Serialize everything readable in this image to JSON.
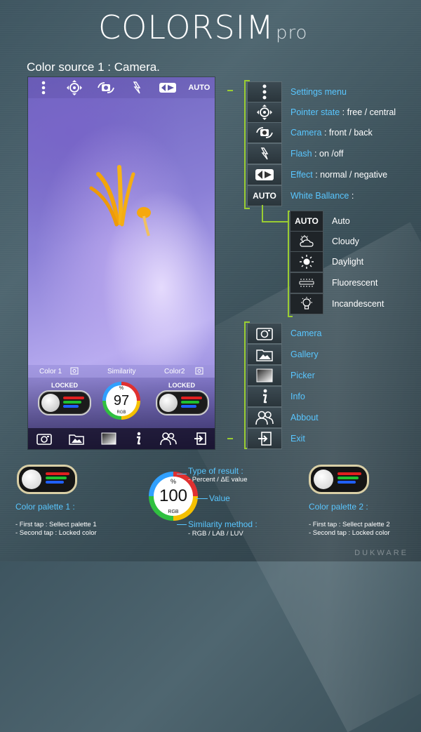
{
  "title": {
    "main": "COLORSIM",
    "sub": "pro"
  },
  "source_label": "Color source 1 : Camera.",
  "phone": {
    "top_auto": "AUTO",
    "panel": {
      "color1": "Color 1",
      "similarity": "Similarity",
      "color2": "Color2",
      "locked_left": "LOCKED",
      "locked_right": "LOCKED",
      "gauge_pct": "%",
      "gauge_value": "97",
      "gauge_method": "RGB"
    }
  },
  "top_menu": [
    {
      "icon": "dots-vertical-icon",
      "label": "Settings menu",
      "detail": ""
    },
    {
      "icon": "pointer-target-icon",
      "label": "Pointer state",
      "detail": " : free / central"
    },
    {
      "icon": "camera-switch-icon",
      "label": "Camera",
      "detail": "  : front / back"
    },
    {
      "icon": "flash-icon",
      "label": "Flash",
      "detail": " : on /off"
    },
    {
      "icon": "effect-icon",
      "label": "Effect",
      "detail": " : normal / negative"
    },
    {
      "icon": "auto-wb-icon",
      "label": "White Ballance",
      "detail": " :",
      "btn_text": "AUTO"
    }
  ],
  "wb_menu": [
    {
      "icon": "auto-icon",
      "label": "Auto",
      "btn_text": "AUTO"
    },
    {
      "icon": "cloudy-icon",
      "label": "Cloudy"
    },
    {
      "icon": "daylight-icon",
      "label": "Daylight"
    },
    {
      "icon": "fluorescent-icon",
      "label": "Fluorescent"
    },
    {
      "icon": "incandescent-icon",
      "label": "Incandescent"
    }
  ],
  "bottom_menu": [
    {
      "icon": "camera-icon",
      "label": "Camera"
    },
    {
      "icon": "gallery-icon",
      "label": "Gallery"
    },
    {
      "icon": "picker-icon",
      "label": "Picker"
    },
    {
      "icon": "info-icon",
      "label": "Info"
    },
    {
      "icon": "about-icon",
      "label": "Abbout"
    },
    {
      "icon": "exit-icon",
      "label": "Exit"
    }
  ],
  "legend": {
    "palette1_title": "Color palette 1 :",
    "palette1_line1": "- First tap : Sellect palette 1",
    "palette1_line2": "- Second tap : Locked color",
    "palette2_title": "Color palette 2 :",
    "palette2_line1": "- First tap : Sellect palette 2",
    "palette2_line2": "- Second tap : Locked color",
    "gauge_pct": "%",
    "gauge_value": "100",
    "gauge_method": "RGB",
    "type_title": "Type of result :",
    "type_sub": "- Percent / ΔE value",
    "value_title": "Value",
    "method_title": "Similarity method :",
    "method_sub": "- RGB / LAB / LUV"
  },
  "watermark": "DUKWARE",
  "colors": {
    "accent": "#59c6ff",
    "bracket": "#9acd32"
  }
}
